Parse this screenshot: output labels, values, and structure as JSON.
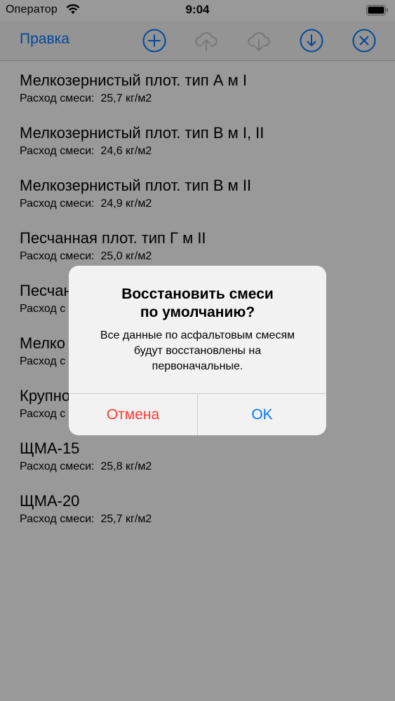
{
  "status_bar": {
    "carrier": "Оператор",
    "time": "9:04"
  },
  "nav_bar": {
    "edit_label": "Правка",
    "icons": [
      "plus-circle-icon",
      "cloud-upload-icon",
      "cloud-download-icon",
      "download-circle-icon",
      "close-circle-icon"
    ]
  },
  "list": {
    "items": [
      {
        "title": "Мелкозернистый плот. тип А м I",
        "sub_label": "Расход смеси:",
        "value": "25,7 кг/м2"
      },
      {
        "title": "Мелкозернистый плот. тип В м I, II",
        "sub_label": "Расход смеси:",
        "value": "24,6 кг/м2"
      },
      {
        "title": "Мелкозернистый плот. тип В м II",
        "sub_label": "Расход смеси:",
        "value": "24,9 кг/м2"
      },
      {
        "title": "Песчанная плот. тип Г м II",
        "sub_label": "Расход смеси:",
        "value": "25,0 кг/м2"
      },
      {
        "title": "Песчан",
        "sub_label": "Расход с",
        "value": ""
      },
      {
        "title": "Мелко",
        "sub_label": "Расход с",
        "value": ""
      },
      {
        "title": "Крупно",
        "sub_label": "Расход с",
        "value": ""
      },
      {
        "title": "ЩМА-15",
        "sub_label": "Расход смеси:",
        "value": "25,8 кг/м2"
      },
      {
        "title": "ЩМА-20",
        "sub_label": "Расход смеси:",
        "value": "25,7 кг/м2"
      }
    ]
  },
  "alert": {
    "title_line1": "Восстановить смеси",
    "title_line2": "по умолчанию?",
    "message_line1": "Все данные по асфальтовым смесям",
    "message_line2": "будут восстановлены на",
    "message_line3": "первоначальные.",
    "cancel_label": "Отмена",
    "ok_label": "OK"
  },
  "colors": {
    "accent": "#007aff",
    "destructive": "#ff3b30",
    "disabled": "#c7c7cc"
  }
}
